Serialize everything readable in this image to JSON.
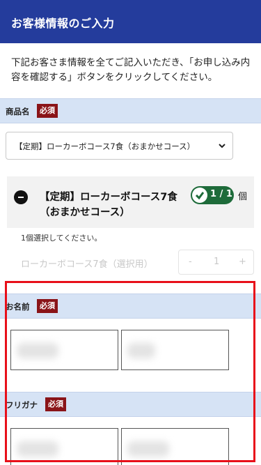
{
  "header": {
    "title": "お客様情報のご入力"
  },
  "intro": {
    "text": "下記お客さま情報を全てご記入いただき、「お申し込み内容を確認する」ボタンをクリックしてください。"
  },
  "product": {
    "label": "商品名",
    "required_badge": "必須",
    "select_value": "【定期】ローカーボコース7食（おまかせコース）",
    "course_name": "【定期】ローカーボコース7食（おまかせコース）",
    "count": "1 / 1",
    "count_unit": "個",
    "hint": "1個選択してください。",
    "option_label": "ローカーボコース7食（選択用）",
    "stepper": {
      "minus": "-",
      "value": "1",
      "plus": "+"
    }
  },
  "name": {
    "label": "お名前",
    "required_badge": "必須"
  },
  "furigana": {
    "label": "フリガナ",
    "required_badge": "必須"
  },
  "colors": {
    "header": "#243c9c",
    "band": "#d6e3f5",
    "badge": "#8a1418",
    "count_pill": "#1e6b3a",
    "highlight": "#e8101a"
  }
}
